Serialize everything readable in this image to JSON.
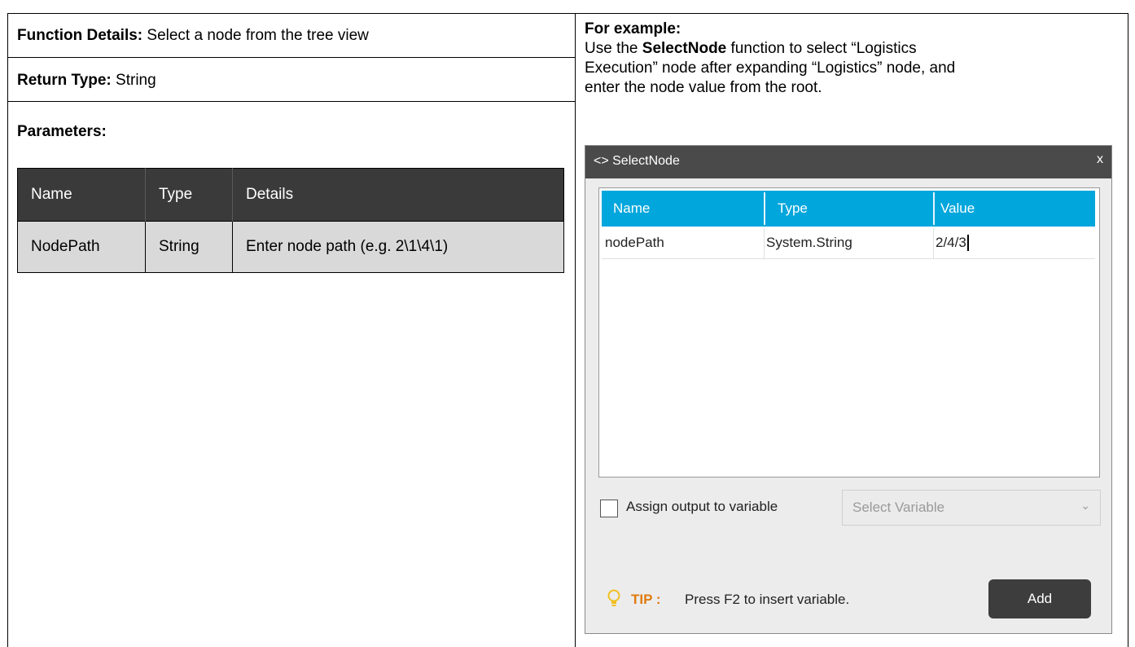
{
  "left": {
    "function_details_label": "Function Details:",
    "function_details_value": " Select a node from the tree view",
    "return_type_label": "Return Type:",
    "return_type_value": " String",
    "parameters_label": "Parameters:",
    "param_table": {
      "headers": [
        "Name",
        "Type",
        "Details"
      ],
      "rows": [
        [
          "NodePath",
          "String",
          "Enter node path (e.g. 2\\1\\4\\1)"
        ]
      ]
    }
  },
  "right": {
    "example_label": "For example:",
    "example_line1_pre": "Use the ",
    "example_line1_bold": "SelectNode",
    "example_line1_post": " function to select “Logistics",
    "example_line2": "Execution” node after expanding “Logistics” node, and",
    "example_line3": "enter the node value from the root."
  },
  "dialog": {
    "title": "<> SelectNode",
    "close": "x",
    "grid_headers": [
      "Name",
      "Type",
      "Value"
    ],
    "grid_row": {
      "name": "nodePath",
      "type": "System.String",
      "value": "2/4/3"
    },
    "assign_label": "Assign output to variable",
    "select_placeholder": "Select Variable",
    "tip_label": "TIP :",
    "tip_text": "Press F2 to insert variable.",
    "add_label": "Add",
    "colors": {
      "grid_header": "#00a6dc",
      "title_bar": "#4a4a4a",
      "tip": "#e07a10"
    }
  }
}
